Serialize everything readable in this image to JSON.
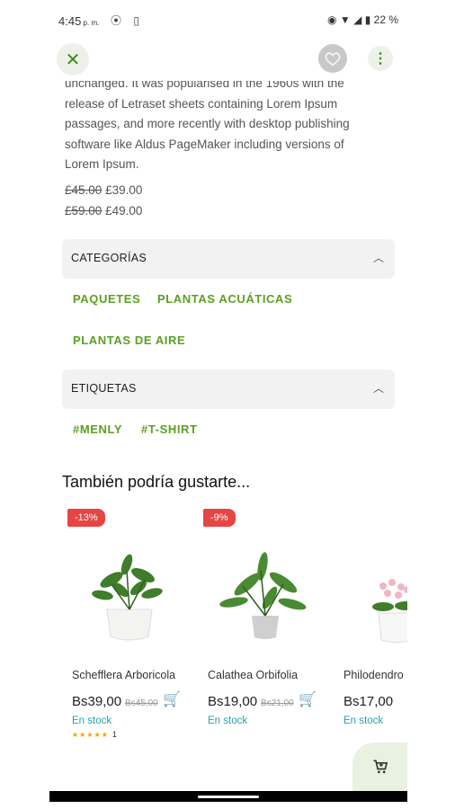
{
  "status": {
    "time": "4:45",
    "ampm": "p. m.",
    "battery": "22 %"
  },
  "description_lines": [
    "unchanged. It was popularised in the 1960s with the",
    "release of Letraset sheets containing Lorem Ipsum",
    "passages, and more recently with desktop publishing",
    "software like Aldus PageMaker including versions of",
    "Lorem Ipsum."
  ],
  "prices": [
    {
      "old": "£45.00",
      "new": "£39.00"
    },
    {
      "old": "£59.00",
      "new": "£49.00"
    }
  ],
  "categories": {
    "title": "CATEGORÍAS",
    "items": [
      "PAQUETES",
      "PLANTAS ACUÁTICAS",
      "PLANTAS DE AIRE"
    ]
  },
  "tags": {
    "title": "ETIQUETAS",
    "items": [
      "#MENLY",
      "#T-SHIRT"
    ]
  },
  "related": {
    "title": "También podría gustarte...",
    "products": [
      {
        "badge": "-13%",
        "name": "Schefflera Arboricola",
        "price": "Bs39,00",
        "old_price": "Bs45,00",
        "stock": "En stock",
        "rating_count": "1"
      },
      {
        "badge": "-9%",
        "name": "Calathea Orbifolia",
        "price": "Bs19,00",
        "old_price": "Bs21,00",
        "stock": "En stock"
      },
      {
        "name": "Philodendro",
        "price": "Bs17,00",
        "stock": "En stock"
      }
    ]
  },
  "colors": {
    "accent_green": "#5ba021",
    "sale_badge": "#e64545",
    "stock_teal": "#2aa0a8"
  }
}
